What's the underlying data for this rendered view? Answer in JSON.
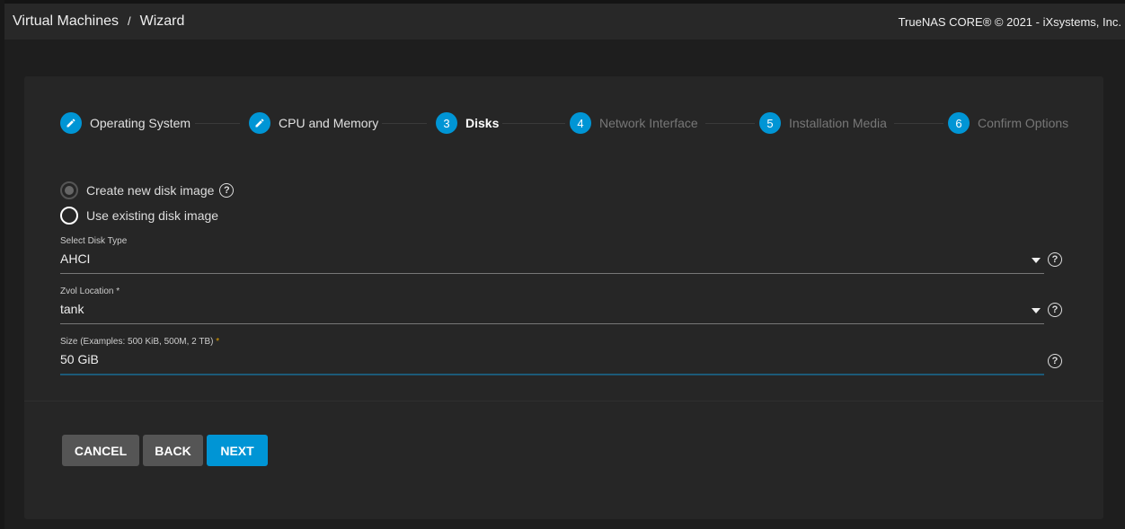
{
  "header": {
    "breadcrumb": [
      "Virtual Machines",
      "Wizard"
    ],
    "separator": "/",
    "copyright": "TrueNAS CORE® © 2021 - iXsystems, Inc."
  },
  "steps": [
    {
      "num": "",
      "label": "Operating System",
      "state": "done",
      "icon": "pencil-icon"
    },
    {
      "num": "",
      "label": "CPU and Memory",
      "state": "done",
      "icon": "pencil-icon"
    },
    {
      "num": "3",
      "label": "Disks",
      "state": "active"
    },
    {
      "num": "4",
      "label": "Network Interface",
      "state": "todo"
    },
    {
      "num": "5",
      "label": "Installation Media",
      "state": "todo"
    },
    {
      "num": "6",
      "label": "Confirm Options",
      "state": "todo"
    }
  ],
  "form": {
    "radio_create": "Create new disk image",
    "radio_existing": "Use existing disk image",
    "selected": "create",
    "disk_type": {
      "label": "Select Disk Type",
      "value": "AHCI"
    },
    "zvol": {
      "label": "Zvol Location",
      "required": "*",
      "value": "tank"
    },
    "size": {
      "label": "Size (Examples: 500 KiB, 500M, 2 TB)",
      "required": "*",
      "value": "50 GiB"
    },
    "help": "?"
  },
  "buttons": {
    "cancel": "CANCEL",
    "back": "BACK",
    "next": "NEXT"
  },
  "colors": {
    "accent": "#0095d5",
    "background": "#1e1e1e",
    "card": "#262626"
  }
}
